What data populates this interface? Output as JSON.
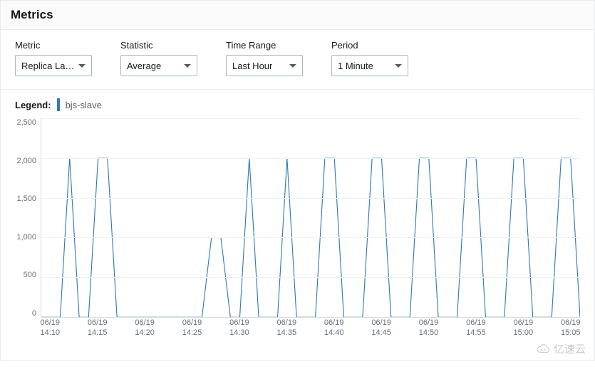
{
  "panel": {
    "title": "Metrics"
  },
  "controls": {
    "metric": {
      "label": "Metric",
      "value": "Replica La…"
    },
    "statistic": {
      "label": "Statistic",
      "value": "Average"
    },
    "timerange": {
      "label": "Time Range",
      "value": "Last Hour"
    },
    "period": {
      "label": "Period",
      "value": "1 Minute"
    }
  },
  "legend": {
    "label": "Legend:",
    "series_name": "bjs-slave",
    "series_color": "#2f7ab7"
  },
  "watermark": "亿速云",
  "chart_data": {
    "type": "line",
    "title": "",
    "xlabel": "",
    "ylabel": "",
    "ylim": [
      0,
      2500
    ],
    "y_ticks": [
      0,
      500,
      1000,
      1500,
      2000,
      2500
    ],
    "x_ticks": [
      {
        "date": "06/19",
        "time": "14:10"
      },
      {
        "date": "06/19",
        "time": "14:15"
      },
      {
        "date": "06/19",
        "time": "14:20"
      },
      {
        "date": "06/19",
        "time": "14:25"
      },
      {
        "date": "06/19",
        "time": "14:30"
      },
      {
        "date": "06/19",
        "time": "14:35"
      },
      {
        "date": "06/19",
        "time": "14:40"
      },
      {
        "date": "06/19",
        "time": "14:45"
      },
      {
        "date": "06/19",
        "time": "14:50"
      },
      {
        "date": "06/19",
        "time": "14:55"
      },
      {
        "date": "06/19",
        "time": "15:00"
      },
      {
        "date": "06/19",
        "time": "15:05"
      }
    ],
    "series": [
      {
        "name": "bjs-slave",
        "color": "#2f7ab7",
        "x": [
          "14:09",
          "14:10",
          "14:11",
          "14:12",
          "14:13",
          "14:14",
          "14:15",
          "14:16",
          "14:17",
          "14:18",
          "14:19",
          "14:20",
          "14:21",
          "14:22",
          "14:23",
          "14:24",
          "14:25",
          "14:26",
          "14:27",
          "14:28",
          "14:29",
          "14:30",
          "14:31",
          "14:32",
          "14:33",
          "14:34",
          "14:35",
          "14:36",
          "14:37",
          "14:38",
          "14:39",
          "14:40",
          "14:41",
          "14:42",
          "14:43",
          "14:44",
          "14:45",
          "14:46",
          "14:47",
          "14:48",
          "14:49",
          "14:50",
          "14:51",
          "14:52",
          "14:53",
          "14:54",
          "14:55",
          "14:56",
          "14:57",
          "14:58",
          "14:59",
          "15:00",
          "15:01",
          "15:02",
          "15:03",
          "15:04",
          "15:05",
          "15:06"
        ],
        "values": [
          0,
          0,
          0,
          2000,
          0,
          0,
          2000,
          2000,
          0,
          0,
          0,
          0,
          0,
          0,
          0,
          0,
          0,
          0,
          1000,
          1000,
          0,
          0,
          2000,
          0,
          0,
          0,
          2000,
          0,
          0,
          0,
          2000,
          2000,
          0,
          0,
          0,
          2000,
          2000,
          0,
          0,
          0,
          2000,
          2000,
          0,
          0,
          0,
          2000,
          2000,
          0,
          0,
          0,
          2000,
          2000,
          0,
          0,
          0,
          2000,
          2000,
          0
        ]
      }
    ]
  }
}
